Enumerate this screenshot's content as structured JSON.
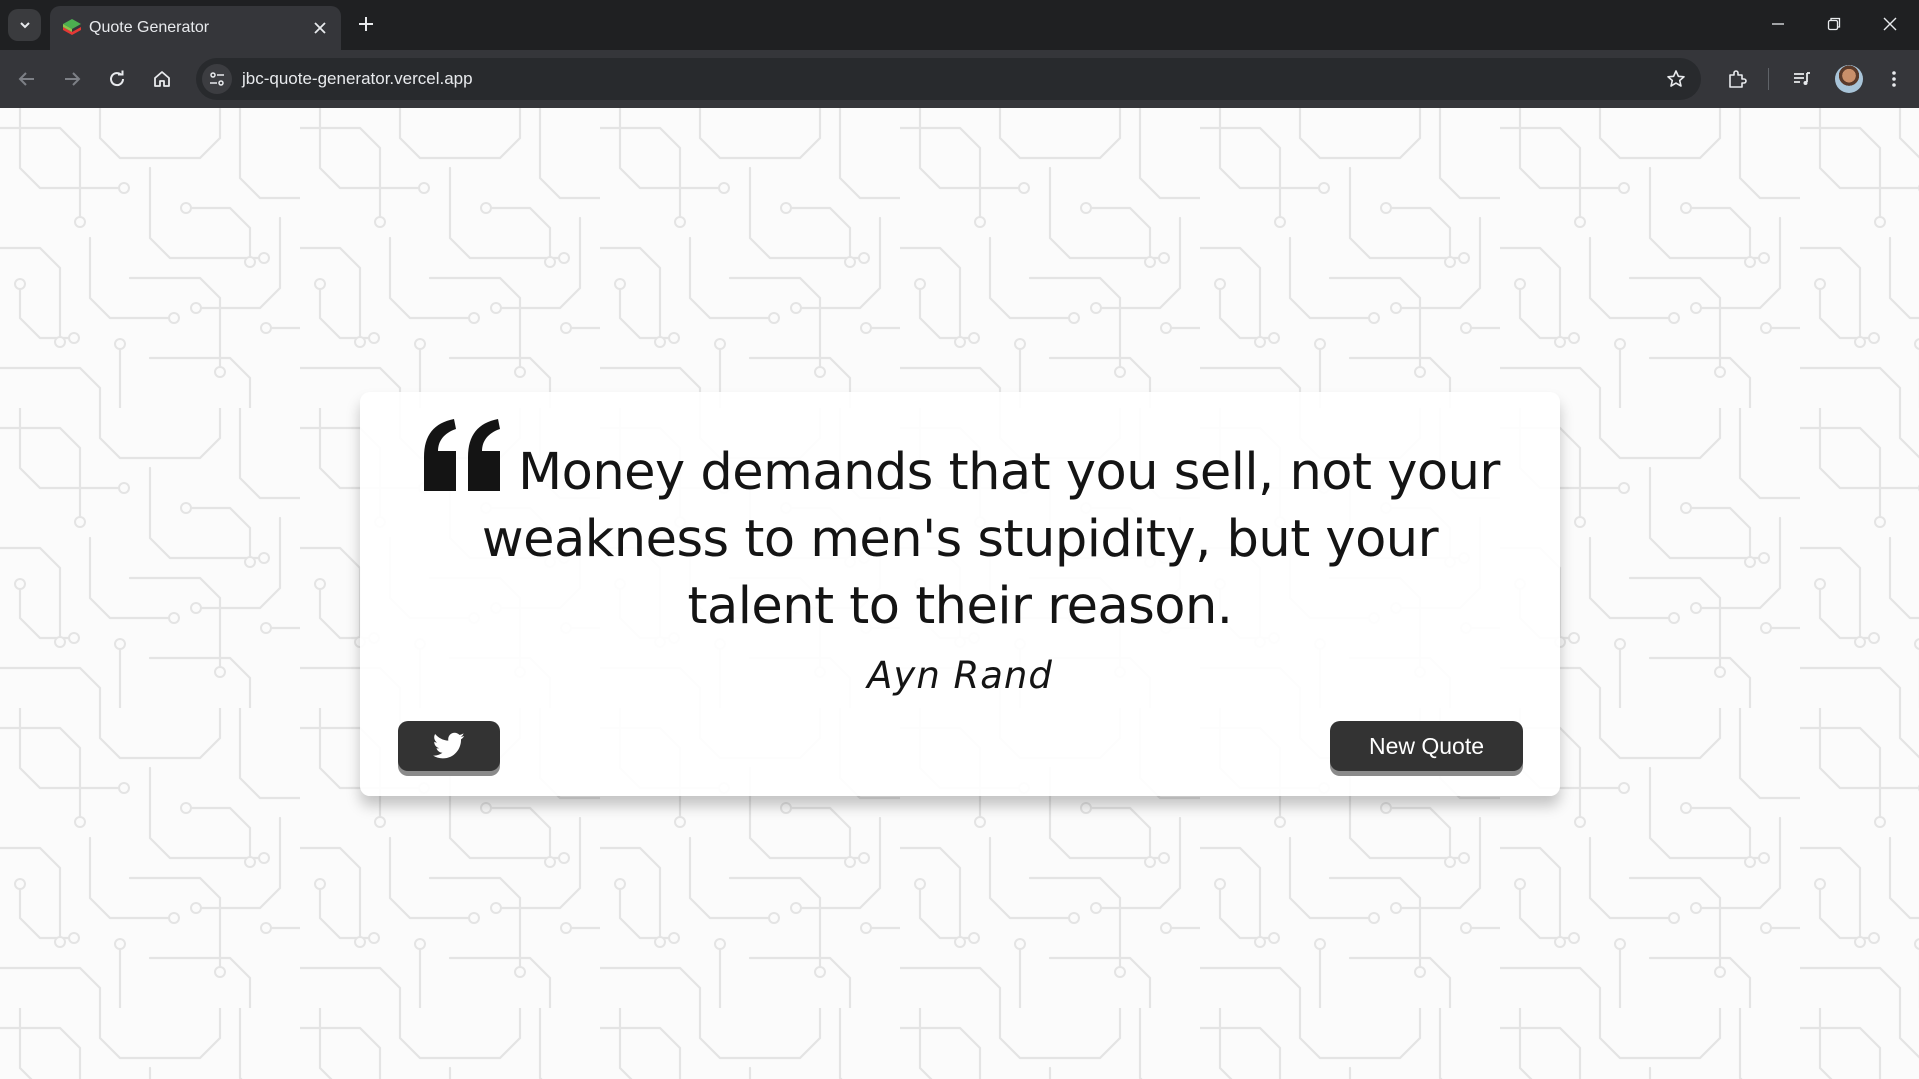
{
  "browser": {
    "tab_title": "Quote Generator",
    "url": "jbc-quote-generator.vercel.app"
  },
  "quote": {
    "text": "Money demands that you sell, not your weakness to men's stupidity, but your talent to their reason.",
    "author": "Ayn Rand"
  },
  "buttons": {
    "twitter_icon": "twitter-icon",
    "new_quote_label": "New Quote"
  }
}
